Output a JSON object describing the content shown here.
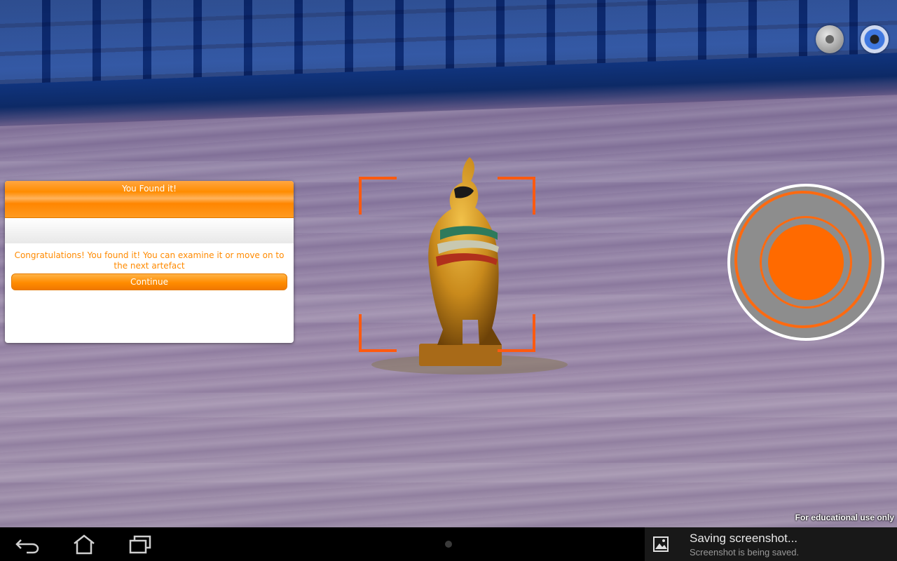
{
  "dialog": {
    "title": "You Found it!",
    "message": "Congratulations! You found it! You can examine it or move on to the next artefact",
    "continue_label": "Continue"
  },
  "watermark": "For educational use only",
  "notification": {
    "title": "Saving screenshot...",
    "subtitle": "Screenshot is being saved."
  },
  "colors": {
    "accent_orange": "#ff8c00",
    "target_orange": "#ff5a10",
    "joystick_orange": "#ff6a00",
    "joystick_grey": "#8d8d8d"
  },
  "icons": {
    "top_left": "grey-orb-icon",
    "top_right": "speaker-orb-icon",
    "nav": [
      "back-icon",
      "home-icon",
      "recent-apps-icon"
    ],
    "notification": "image-icon"
  }
}
